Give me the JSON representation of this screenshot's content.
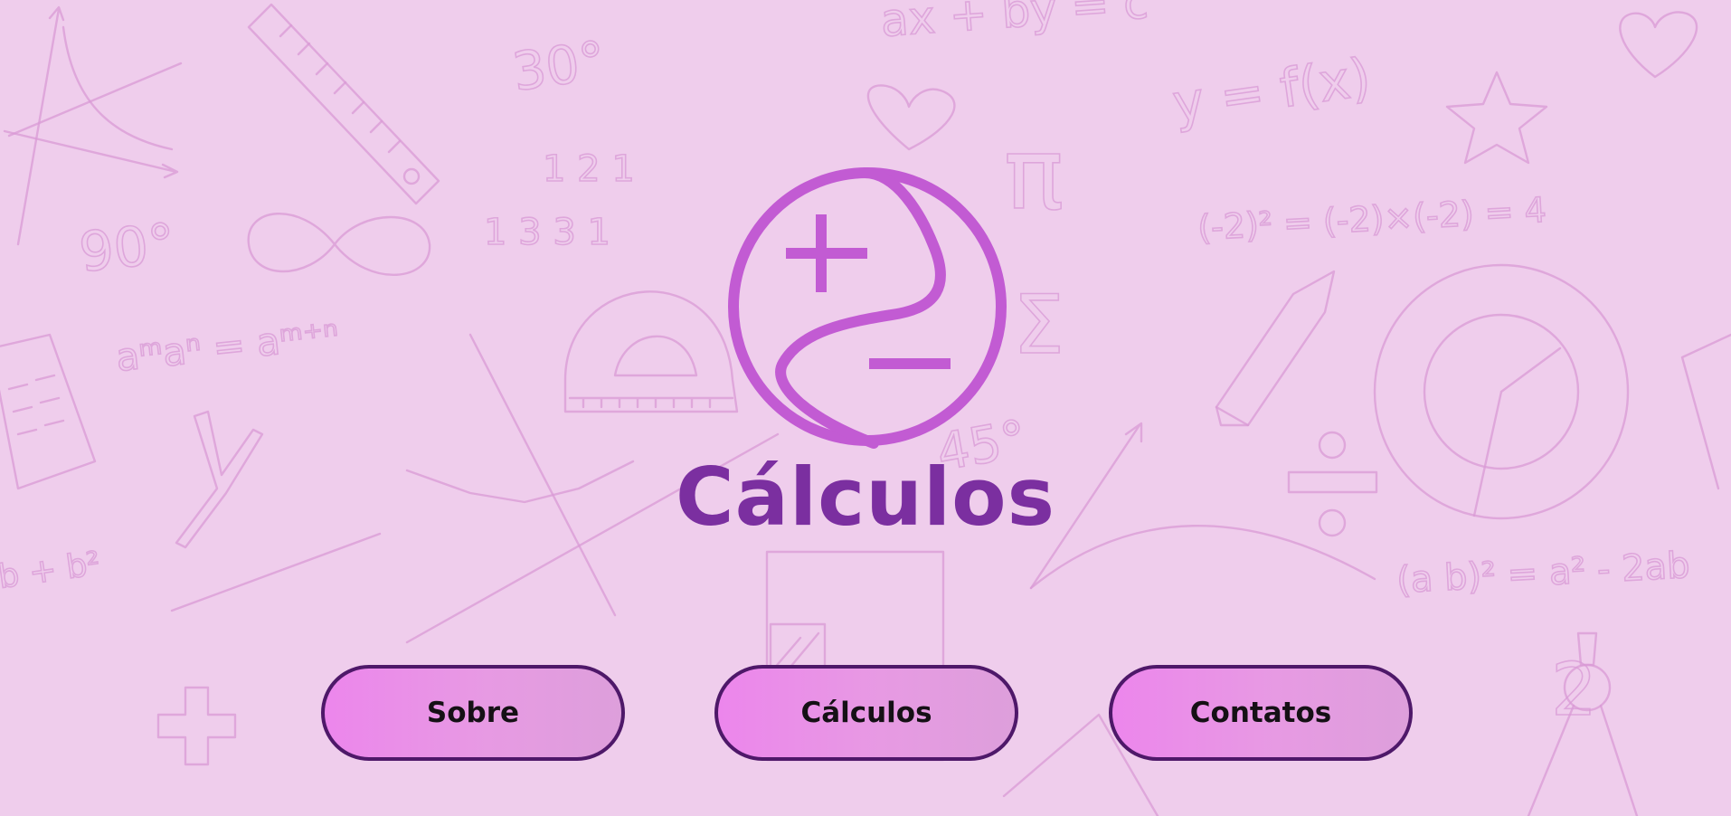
{
  "header": {
    "title": "Cálculos",
    "logo_icon": "plus-minus-circle-icon"
  },
  "nav": {
    "items": [
      {
        "label": "Sobre"
      },
      {
        "label": "Cálculos"
      },
      {
        "label": "Contatos"
      }
    ]
  },
  "colors": {
    "background": "#efcdec",
    "accent": "#c25bd3",
    "title": "#7b2fa0",
    "button_border": "#4e1869",
    "button_fill": "#ec86ec"
  }
}
